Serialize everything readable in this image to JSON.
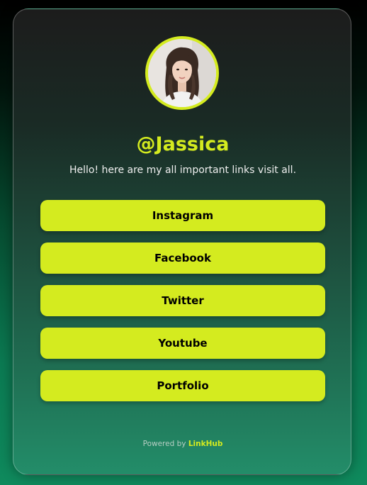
{
  "profile": {
    "handle": "@Jassica",
    "bio": "Hello! here are my all important links visit all.",
    "avatar_alt": "profile photo"
  },
  "links": [
    {
      "label": "Instagram"
    },
    {
      "label": "Facebook"
    },
    {
      "label": "Twitter"
    },
    {
      "label": "Youtube"
    },
    {
      "label": "Portfolio"
    }
  ],
  "footer": {
    "prefix": "Powered by",
    "brand": "LinkHub"
  },
  "colors": {
    "accent": "#d4eb1f",
    "button_text": "#000000"
  }
}
